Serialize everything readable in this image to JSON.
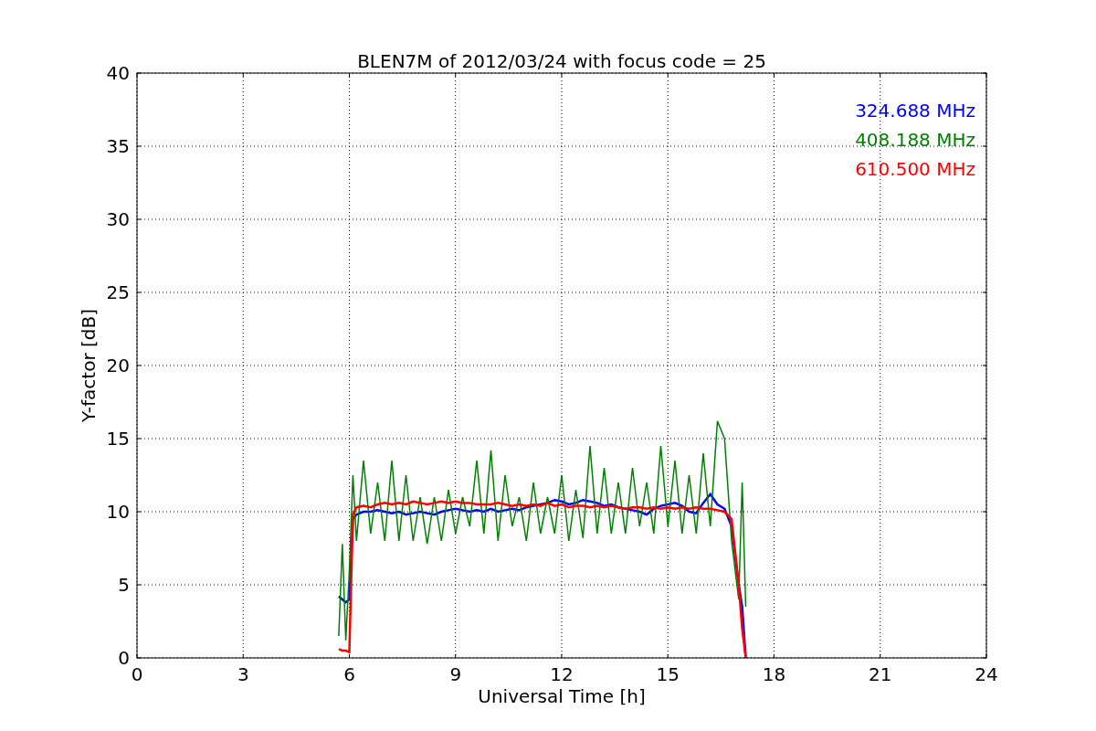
{
  "chart_data": {
    "type": "line",
    "title": "BLEN7M of 2012/03/24 with focus code = 25",
    "xlabel": "Universal Time [h]",
    "ylabel": "Y-factor [dB]",
    "x": [
      5.7,
      5.8,
      5.9,
      6.0,
      6.1,
      6.2,
      6.4,
      6.6,
      6.8,
      7.0,
      7.2,
      7.4,
      7.6,
      7.8,
      8.0,
      8.2,
      8.4,
      8.6,
      8.8,
      9.0,
      9.2,
      9.4,
      9.6,
      9.8,
      10.0,
      10.2,
      10.4,
      10.6,
      10.8,
      11.0,
      11.2,
      11.4,
      11.6,
      11.8,
      12.0,
      12.2,
      12.4,
      12.6,
      12.8,
      13.0,
      13.2,
      13.4,
      13.6,
      13.8,
      14.0,
      14.2,
      14.4,
      14.6,
      14.8,
      15.0,
      15.2,
      15.4,
      15.6,
      15.8,
      16.0,
      16.2,
      16.4,
      16.6,
      16.8,
      17.0,
      17.1,
      17.2
    ],
    "series": [
      {
        "name": "324.688 MHz",
        "color": "#0000ff",
        "values": [
          4.2,
          4.0,
          3.8,
          4.0,
          9.5,
          9.8,
          10,
          10,
          10.1,
          10,
          9.9,
          10,
          9.8,
          9.9,
          10,
          9.9,
          9.8,
          10,
          10.1,
          10.2,
          10.1,
          10,
          10.1,
          10,
          10.2,
          10,
          10.1,
          10.2,
          10.1,
          10.3,
          10.4,
          10.5,
          10.6,
          10.8,
          10.7,
          10.5,
          10.6,
          10.8,
          10.7,
          10.6,
          10.4,
          10.5,
          10.3,
          10.2,
          10.1,
          10,
          9.8,
          10.2,
          10.4,
          10.5,
          10.6,
          10.4,
          10,
          9.9,
          10.6,
          11.2,
          10.5,
          10.2,
          9,
          5,
          3.5,
          0
        ]
      },
      {
        "name": "408.188 MHz",
        "color": "#008000",
        "values": [
          1.5,
          7.8,
          1.2,
          6,
          12.5,
          8,
          13.5,
          8.5,
          12,
          8,
          13.5,
          8,
          12.5,
          8,
          11,
          7.8,
          11,
          8,
          11.5,
          8.5,
          11,
          9,
          13.5,
          8.5,
          14.2,
          8,
          12.5,
          9,
          11,
          8,
          12,
          8.5,
          11,
          8.5,
          12.5,
          8,
          11.5,
          8.2,
          14.5,
          8.5,
          13,
          8.5,
          12,
          8.5,
          13,
          9,
          12,
          8.5,
          14.5,
          9,
          13.5,
          8.5,
          12.5,
          8.5,
          14,
          9,
          16.2,
          15,
          8,
          4,
          12,
          3.5
        ]
      },
      {
        "name": "610.500 MHz",
        "color": "#ff0000",
        "values": [
          0.6,
          0.5,
          0.5,
          0.4,
          9.8,
          10.3,
          10.4,
          10.3,
          10.5,
          10.6,
          10.5,
          10.6,
          10.5,
          10.7,
          10.6,
          10.5,
          10.6,
          10.7,
          10.6,
          10.7,
          10.6,
          10.6,
          10.5,
          10.5,
          10.5,
          10.6,
          10.5,
          10.4,
          10.5,
          10.4,
          10.5,
          10.4,
          10.6,
          10.4,
          10.5,
          10.3,
          10.4,
          10.4,
          10.3,
          10.4,
          10.3,
          10.4,
          10.3,
          10.2,
          10.3,
          10.3,
          10.2,
          10.3,
          10.2,
          10.3,
          10.2,
          10.3,
          10.2,
          10.3,
          10.2,
          10.2,
          10.1,
          10.0,
          9.5,
          5,
          2,
          0
        ]
      }
    ],
    "xlim": [
      0,
      24
    ],
    "ylim": [
      0,
      40
    ],
    "xticks": [
      0,
      3,
      6,
      9,
      12,
      15,
      18,
      21,
      24
    ],
    "yticks": [
      0,
      5,
      10,
      15,
      20,
      25,
      30,
      35,
      40
    ],
    "grid": true
  }
}
